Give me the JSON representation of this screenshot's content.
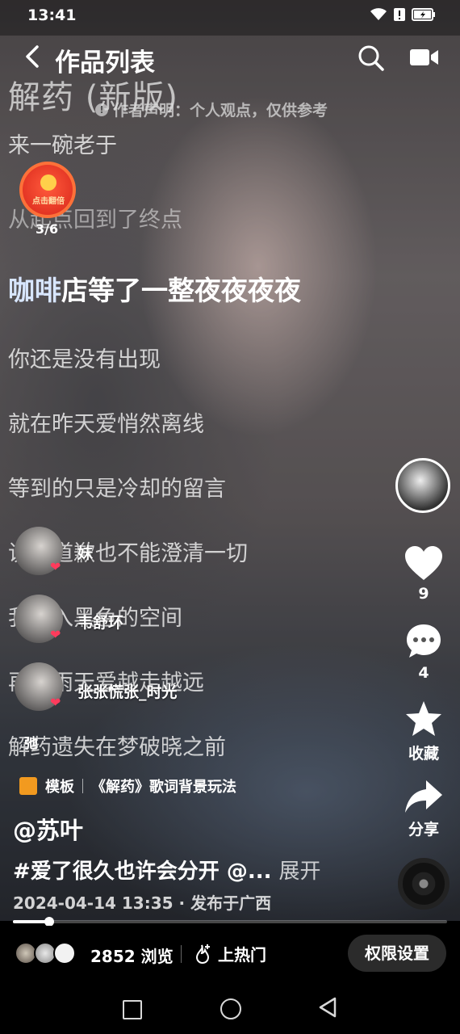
{
  "status": {
    "time": "13:41"
  },
  "header": {
    "title": "作品列表",
    "icons": [
      "back-icon",
      "search-icon",
      "camera-icon"
    ]
  },
  "lyrics": {
    "song_title": "解药 (新版)",
    "disclaimer": "作者声明：个人观点，仅供参考",
    "lines": [
      "来一碗老于",
      "从起点回到了终点",
      "你还是没有出现",
      "就在昨天爱悄然离线",
      "等到的只是冷却的留言",
      "说了道歉也不能澄清一切",
      "我坠入黑色的空间",
      "再一雨天爱越走越远",
      "解药遗失在梦破晓之前"
    ],
    "current_prefix": "咖啡",
    "current_rest": "店等了一整夜夜夜夜"
  },
  "red_packet": {
    "label": "点击翻倍",
    "count": "3/6"
  },
  "fans": [
    {
      "name": "妹"
    },
    {
      "name": "韦舒环"
    },
    {
      "name": "张张慌张_时光"
    },
    {
      "name": "弛"
    }
  ],
  "actions": {
    "like_count": "9",
    "comment_count": "4",
    "favorite_label": "收藏",
    "share_label": "分享"
  },
  "post": {
    "template_tag": "模板",
    "template_name": "《解药》歌词背景玩法",
    "author": "@苏叶",
    "caption": "#爱了很久也许会分开 @...",
    "expand": "展开",
    "date_location": "2024-04-14 13:35 · 发布于广西",
    "progress_fraction": 0.084
  },
  "bottom": {
    "views": "2852 浏览",
    "hot": "上热门",
    "permission_button": "权限设置"
  },
  "colors": {
    "like_red": "#ff3b5c",
    "template_orange": "#f29a1f",
    "red_packet": "#d8261a"
  }
}
